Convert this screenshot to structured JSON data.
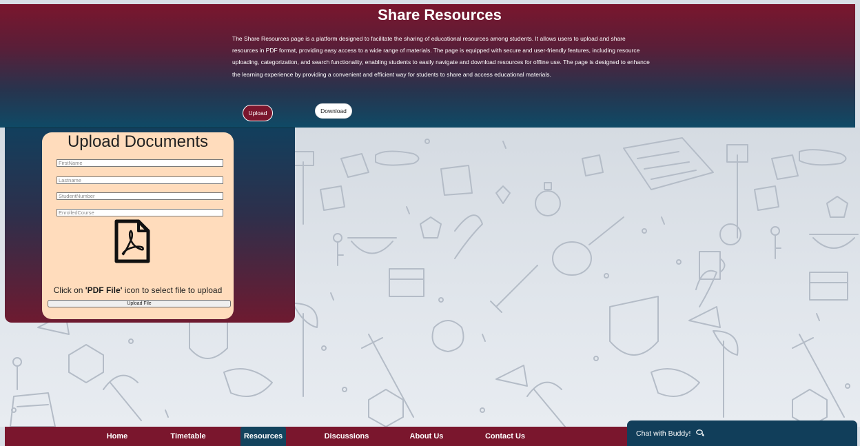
{
  "header": {
    "title": "Share Resources",
    "description": "The Share Resources page is a platform designed to facilitate the sharing of educational resources among students. It allows users to upload and share resources in PDF format, providing easy access to a wide range of materials. The page is equipped with secure and user-friendly features, including resource uploading, categorization, and search functionality, enabling students to easily navigate and download resources for offline use. The page is designed to enhance the learning experience by providing a convenient and efficient way for students to share and access educational materials.",
    "upload_label": "Upload",
    "download_label": "Download"
  },
  "upload_form": {
    "title": "Upload Documents",
    "fields": {
      "first_name": {
        "placeholder": "FirstName",
        "value": ""
      },
      "last_name": {
        "placeholder": "Lastname",
        "value": ""
      },
      "student_number": {
        "placeholder": "StudentNumber",
        "value": ""
      },
      "enrolled_course": {
        "placeholder": "EnrolledCourse",
        "value": ""
      }
    },
    "file_icon": "pdf-file-icon",
    "instruction_prefix": "Click on ",
    "instruction_bold": "'PDF File'",
    "instruction_suffix": " icon to select file to upload",
    "upload_button_label": "Upload File"
  },
  "nav": {
    "items": [
      {
        "label": "Home",
        "active": false
      },
      {
        "label": "Timetable",
        "active": false
      },
      {
        "label": "Resources",
        "active": true
      },
      {
        "label": "Discussions",
        "active": false
      },
      {
        "label": "About Us",
        "active": false
      },
      {
        "label": "Contact Us",
        "active": false
      }
    ]
  },
  "chat": {
    "label": "Chat with Buddy!",
    "icon": "chat-bubbles-icon"
  },
  "colors": {
    "maroon": "#7a162d",
    "navy": "#13435d",
    "card": "#ffdcbc",
    "white": "#ffffff"
  }
}
